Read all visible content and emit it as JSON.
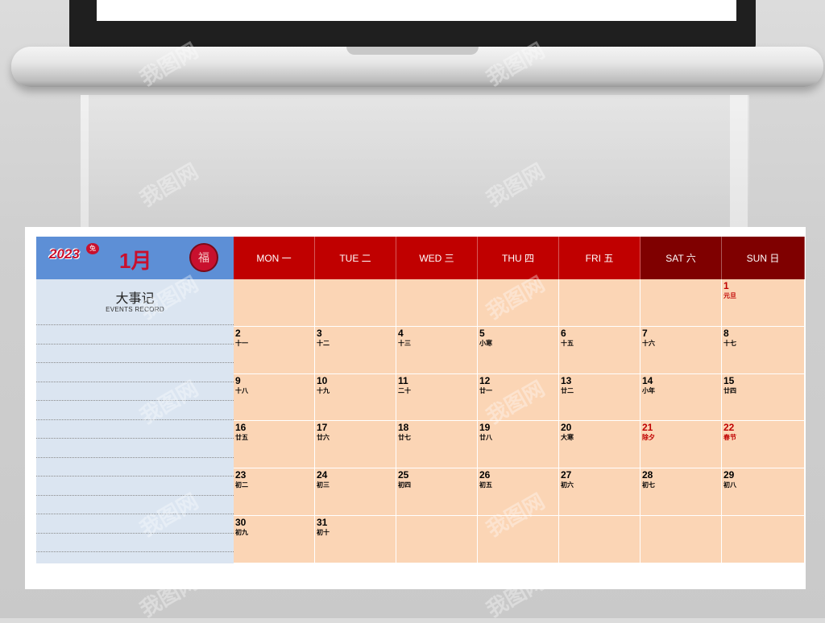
{
  "calendar": {
    "year_badge": "2023",
    "year_animal": "兔",
    "month": "1月",
    "seal_char": "福",
    "events_title": "大事记",
    "events_subtitle": "EVENTS RECORD",
    "weekdays": [
      {
        "label": "MON 一",
        "type": "work"
      },
      {
        "label": "TUE 二",
        "type": "work"
      },
      {
        "label": "WED 三",
        "type": "work"
      },
      {
        "label": "THU 四",
        "type": "work"
      },
      {
        "label": "FRI 五",
        "type": "work"
      },
      {
        "label": "SAT 六",
        "type": "weekend"
      },
      {
        "label": "SUN 日",
        "type": "weekend"
      }
    ],
    "days": [
      {
        "day": "1",
        "lunar": "元旦",
        "holiday": true
      },
      {
        "day": "2",
        "lunar": "十一"
      },
      {
        "day": "3",
        "lunar": "十二"
      },
      {
        "day": "4",
        "lunar": "十三"
      },
      {
        "day": "5",
        "lunar": "小寒"
      },
      {
        "day": "6",
        "lunar": "十五"
      },
      {
        "day": "7",
        "lunar": "十六"
      },
      {
        "day": "8",
        "lunar": "十七"
      },
      {
        "day": "9",
        "lunar": "十八"
      },
      {
        "day": "10",
        "lunar": "十九"
      },
      {
        "day": "11",
        "lunar": "二十"
      },
      {
        "day": "12",
        "lunar": "廿一"
      },
      {
        "day": "13",
        "lunar": "廿二"
      },
      {
        "day": "14",
        "lunar": "小年"
      },
      {
        "day": "15",
        "lunar": "廿四"
      },
      {
        "day": "16",
        "lunar": "廿五"
      },
      {
        "day": "17",
        "lunar": "廿六"
      },
      {
        "day": "18",
        "lunar": "廿七"
      },
      {
        "day": "19",
        "lunar": "廿八"
      },
      {
        "day": "20",
        "lunar": "大寒"
      },
      {
        "day": "21",
        "lunar": "除夕",
        "holiday": true
      },
      {
        "day": "22",
        "lunar": "春节",
        "holiday": true
      },
      {
        "day": "23",
        "lunar": "初二"
      },
      {
        "day": "24",
        "lunar": "初三"
      },
      {
        "day": "25",
        "lunar": "初四"
      },
      {
        "day": "26",
        "lunar": "初五"
      },
      {
        "day": "27",
        "lunar": "初六"
      },
      {
        "day": "28",
        "lunar": "初七"
      },
      {
        "day": "29",
        "lunar": "初八"
      },
      {
        "day": "30",
        "lunar": "初九"
      },
      {
        "day": "31",
        "lunar": "初十"
      }
    ],
    "first_weekday_index": 6,
    "colors": {
      "header_blue": "#5d8fd6",
      "events_panel": "#dbe5f1",
      "weekday_red": "#c00000",
      "weekend_dark_red": "#7f0000",
      "cell_peach": "#fbd5b5",
      "holiday_red": "#c00000"
    }
  },
  "watermark": "我图网"
}
